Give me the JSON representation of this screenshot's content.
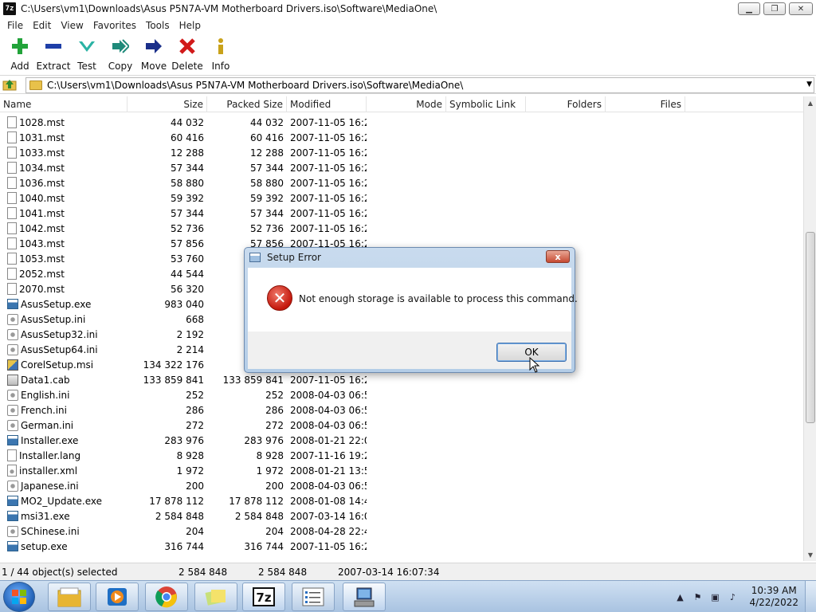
{
  "window": {
    "app_badge": "7z",
    "title": "C:\\Users\\vm1\\Downloads\\Asus P5N7A-VM Motherboard Drivers.iso\\Software\\MediaOne\\"
  },
  "menu": [
    "File",
    "Edit",
    "View",
    "Favorites",
    "Tools",
    "Help"
  ],
  "toolbar": [
    {
      "label": "Add",
      "icon": "plus-icon",
      "color": "#22a33a"
    },
    {
      "label": "Extract",
      "icon": "minus-icon",
      "color": "#1f3fa8"
    },
    {
      "label": "Test",
      "icon": "check-icon",
      "color": "#2bb3a4"
    },
    {
      "label": "Copy",
      "icon": "double-arrow-icon",
      "color": "#1f8a7a"
    },
    {
      "label": "Move",
      "icon": "arrow-right-icon",
      "color": "#1a2f8a"
    },
    {
      "label": "Delete",
      "icon": "x-icon",
      "color": "#d11a1a"
    },
    {
      "label": "Info",
      "icon": "info-icon",
      "color": "#c9a21a"
    }
  ],
  "address": {
    "path": "C:\\Users\\vm1\\Downloads\\Asus P5N7A-VM Motherboard Drivers.iso\\Software\\MediaOne\\"
  },
  "columns": [
    "Name",
    "Size",
    "Packed Size",
    "Modified",
    "Mode",
    "Symbolic Link",
    "Folders",
    "Files"
  ],
  "files": [
    {
      "name": "1028.mst",
      "size": "44 032",
      "packed": "44 032",
      "modified": "2007-11-05 16:22",
      "type": "doc"
    },
    {
      "name": "1031.mst",
      "size": "60 416",
      "packed": "60 416",
      "modified": "2007-11-05 16:22",
      "type": "doc"
    },
    {
      "name": "1033.mst",
      "size": "12 288",
      "packed": "12 288",
      "modified": "2007-11-05 16:22",
      "type": "doc"
    },
    {
      "name": "1034.mst",
      "size": "57 344",
      "packed": "57 344",
      "modified": "2007-11-05 16:22",
      "type": "doc"
    },
    {
      "name": "1036.mst",
      "size": "58 880",
      "packed": "58 880",
      "modified": "2007-11-05 16:22",
      "type": "doc"
    },
    {
      "name": "1040.mst",
      "size": "59 392",
      "packed": "59 392",
      "modified": "2007-11-05 16:22",
      "type": "doc"
    },
    {
      "name": "1041.mst",
      "size": "57 344",
      "packed": "57 344",
      "modified": "2007-11-05 16:22",
      "type": "doc"
    },
    {
      "name": "1042.mst",
      "size": "52 736",
      "packed": "52 736",
      "modified": "2007-11-05 16:22",
      "type": "doc"
    },
    {
      "name": "1043.mst",
      "size": "57 856",
      "packed": "57 856",
      "modified": "2007-11-05 16:22",
      "type": "doc"
    },
    {
      "name": "1053.mst",
      "size": "53 760",
      "packed": "",
      "modified": "",
      "type": "doc"
    },
    {
      "name": "2052.mst",
      "size": "44 544",
      "packed": "",
      "modified": "",
      "type": "doc"
    },
    {
      "name": "2070.mst",
      "size": "56 320",
      "packed": "",
      "modified": "",
      "type": "doc"
    },
    {
      "name": "AsusSetup.exe",
      "size": "983 040",
      "packed": "",
      "modified": "",
      "type": "exe"
    },
    {
      "name": "AsusSetup.ini",
      "size": "668",
      "packed": "",
      "modified": "",
      "type": "ini"
    },
    {
      "name": "AsusSetup32.ini",
      "size": "2 192",
      "packed": "",
      "modified": "",
      "type": "ini"
    },
    {
      "name": "AsusSetup64.ini",
      "size": "2 214",
      "packed": "",
      "modified": "",
      "type": "ini"
    },
    {
      "name": "CorelSetup.msi",
      "size": "134 322 176",
      "packed": "13",
      "modified": "",
      "type": "msi"
    },
    {
      "name": "Data1.cab",
      "size": "133 859 841",
      "packed": "133 859 841",
      "modified": "2007-11-05 16:21",
      "type": "cab"
    },
    {
      "name": "English.ini",
      "size": "252",
      "packed": "252",
      "modified": "2008-04-03 06:55",
      "type": "ini"
    },
    {
      "name": "French.ini",
      "size": "286",
      "packed": "286",
      "modified": "2008-04-03 06:56",
      "type": "ini"
    },
    {
      "name": "German.ini",
      "size": "272",
      "packed": "272",
      "modified": "2008-04-03 06:56",
      "type": "ini"
    },
    {
      "name": "Installer.exe",
      "size": "283 976",
      "packed": "283 976",
      "modified": "2008-01-21 22:00",
      "type": "exe"
    },
    {
      "name": "Installer.lang",
      "size": "8 928",
      "packed": "8 928",
      "modified": "2007-11-16 19:29",
      "type": "doc"
    },
    {
      "name": "installer.xml",
      "size": "1 972",
      "packed": "1 972",
      "modified": "2008-01-21 13:57",
      "type": "xml"
    },
    {
      "name": "Japanese.ini",
      "size": "200",
      "packed": "200",
      "modified": "2008-04-03 06:56",
      "type": "ini"
    },
    {
      "name": "MO2_Update.exe",
      "size": "17 878 112",
      "packed": "17 878 112",
      "modified": "2008-01-08 14:47",
      "type": "exe"
    },
    {
      "name": "msi31.exe",
      "size": "2 584 848",
      "packed": "2 584 848",
      "modified": "2007-03-14 16:07",
      "type": "exe"
    },
    {
      "name": "SChinese.ini",
      "size": "204",
      "packed": "204",
      "modified": "2008-04-28 22:44",
      "type": "ini"
    },
    {
      "name": "setup.exe",
      "size": "316 744",
      "packed": "316 744",
      "modified": "2007-11-05 16:22",
      "type": "exe"
    }
  ],
  "status": {
    "selected": "1 / 44 object(s) selected",
    "size": "2 584 848",
    "packed": "2 584 848",
    "modified": "2007-03-14 16:07:34"
  },
  "dialog": {
    "title": "Setup Error",
    "message": "Not enough storage is available to process this command.",
    "ok_label": "OK",
    "close_glyph": "x"
  },
  "taskbar": {
    "apps": [
      "explorer-icon",
      "media-player-icon",
      "chrome-icon",
      "sticky-notes-icon",
      "7zip-icon",
      "task-list-icon",
      "setup-icon"
    ],
    "time": "10:39 AM",
    "date": "4/22/2022"
  }
}
